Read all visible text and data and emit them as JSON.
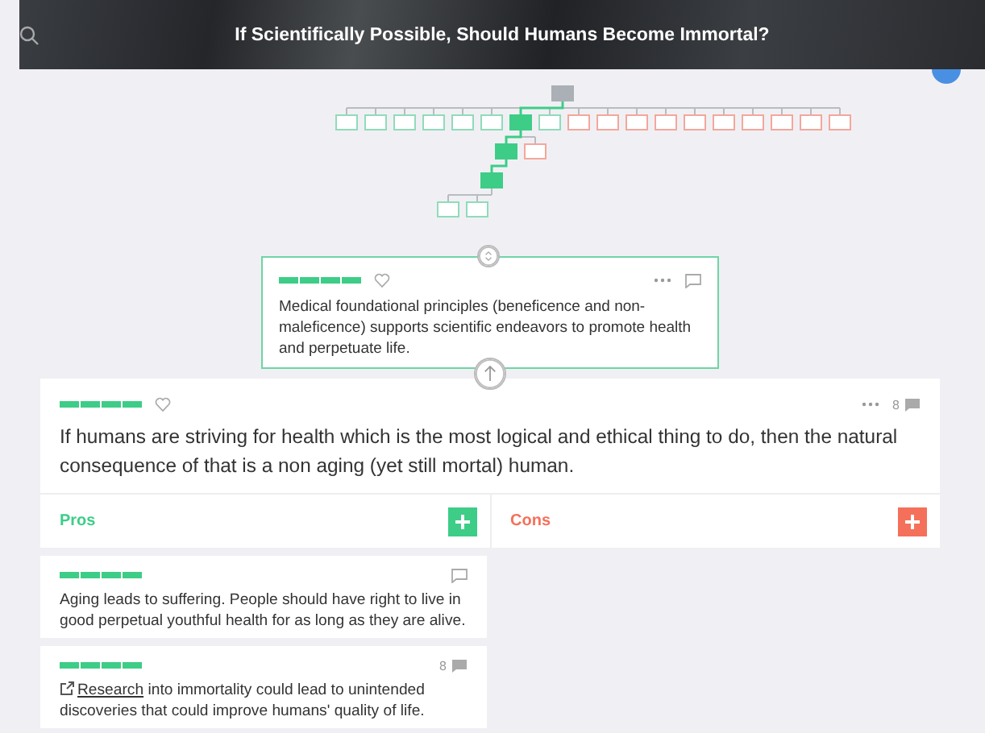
{
  "header": {
    "title": "If Scientifically Possible, Should Humans Become Immortal?"
  },
  "tree": {
    "selected": false,
    "children": [
      {
        "kind": "pro",
        "selected": false
      },
      {
        "kind": "pro",
        "selected": false
      },
      {
        "kind": "pro",
        "selected": false
      },
      {
        "kind": "pro",
        "selected": false
      },
      {
        "kind": "pro",
        "selected": false
      },
      {
        "kind": "pro",
        "selected": false
      },
      {
        "kind": "pro",
        "selected": true,
        "children": [
          {
            "kind": "pro",
            "selected": true,
            "children": [
              {
                "kind": "pro",
                "selected": true,
                "children": [
                  {
                    "kind": "pro",
                    "selected": false
                  },
                  {
                    "kind": "pro",
                    "selected": false
                  }
                ]
              }
            ]
          },
          {
            "kind": "con",
            "selected": false
          }
        ]
      },
      {
        "kind": "pro",
        "selected": false
      },
      {
        "kind": "con",
        "selected": false
      },
      {
        "kind": "con",
        "selected": false
      },
      {
        "kind": "con",
        "selected": false
      },
      {
        "kind": "con",
        "selected": false
      },
      {
        "kind": "con",
        "selected": false
      },
      {
        "kind": "con",
        "selected": false
      },
      {
        "kind": "con",
        "selected": false
      },
      {
        "kind": "con",
        "selected": false
      },
      {
        "kind": "con",
        "selected": false
      },
      {
        "kind": "con",
        "selected": false
      }
    ]
  },
  "parent_claim": {
    "text": "Medical foundational principles (beneficence and non-maleficence) supports scientific endeavors to promote health and perpetuate life."
  },
  "claim": {
    "comment_count": "8",
    "text": "If humans are striving for health which is the most logical and ethical thing to do, then the natural consequence of that is a non aging (yet still mortal) human."
  },
  "columns": [
    {
      "kind": "pro",
      "label": "Pros"
    },
    {
      "kind": "con",
      "label": "Cons"
    }
  ],
  "pros": [
    {
      "text": "Aging leads to suffering. People should have right to live in good perpetual youthful health for as long as they are alive."
    },
    {
      "comment_count": "8",
      "link": "Research",
      "text": " into immortality could lead to unintended discoveries that could improve humans' quality of life."
    }
  ]
}
